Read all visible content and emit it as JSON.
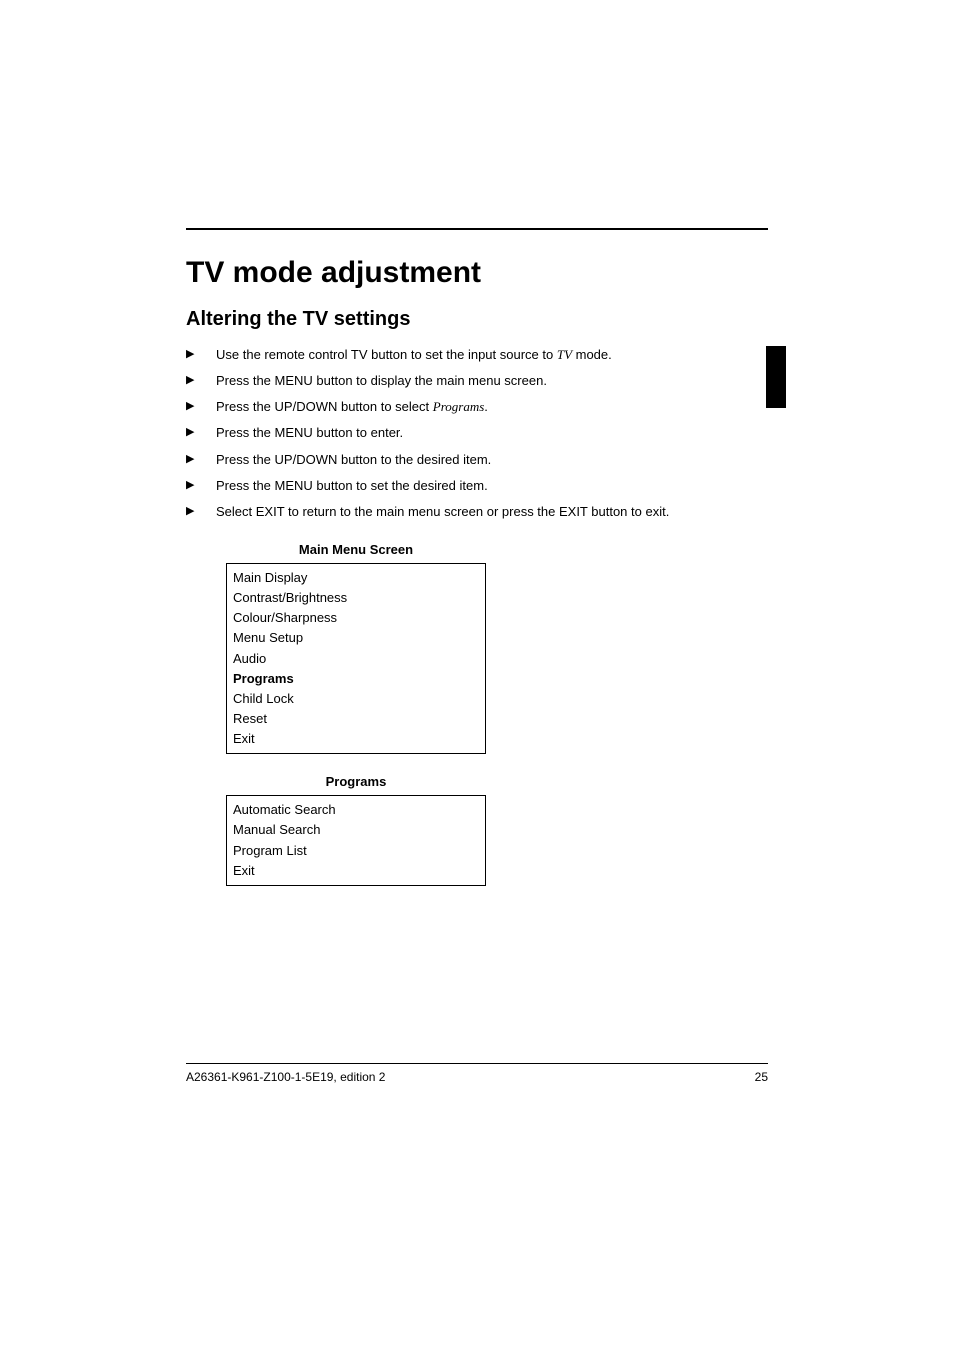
{
  "title": "TV mode adjustment",
  "subtitle": "Altering the TV settings",
  "steps": [
    {
      "pre": "Use the remote control TV button to set the input source to ",
      "it": "TV",
      "post": " mode."
    },
    {
      "pre": "Press the MENU button to display the main menu screen.",
      "it": "",
      "post": ""
    },
    {
      "pre": "Press the UP/DOWN button to select ",
      "it": "Programs",
      "post": "."
    },
    {
      "pre": "Press the MENU button to enter.",
      "it": "",
      "post": ""
    },
    {
      "pre": "Press the UP/DOWN button to the desired item.",
      "it": "",
      "post": ""
    },
    {
      "pre": "Press the MENU button to set the desired item.",
      "it": "",
      "post": ""
    },
    {
      "pre": "Select EXIT to return to the main menu screen or press the EXIT button to exit.",
      "it": "",
      "post": ""
    }
  ],
  "main_menu": {
    "title": "Main Menu Screen",
    "items": [
      {
        "label": "Main Display",
        "bold": false
      },
      {
        "label": "Contrast/Brightness",
        "bold": false
      },
      {
        "label": "Colour/Sharpness",
        "bold": false
      },
      {
        "label": "Menu Setup",
        "bold": false
      },
      {
        "label": "Audio",
        "bold": false
      },
      {
        "label": "Programs",
        "bold": true
      },
      {
        "label": "Child Lock",
        "bold": false
      },
      {
        "label": "Reset",
        "bold": false
      },
      {
        "label": "Exit",
        "bold": false
      }
    ]
  },
  "programs_menu": {
    "title": "Programs",
    "items": [
      {
        "label": "Automatic Search"
      },
      {
        "label": "Manual Search"
      },
      {
        "label": "Program List"
      },
      {
        "label": "Exit"
      }
    ]
  },
  "footer": {
    "left": "A26361-K961-Z100-1-5E19, edition 2",
    "right": "25"
  }
}
